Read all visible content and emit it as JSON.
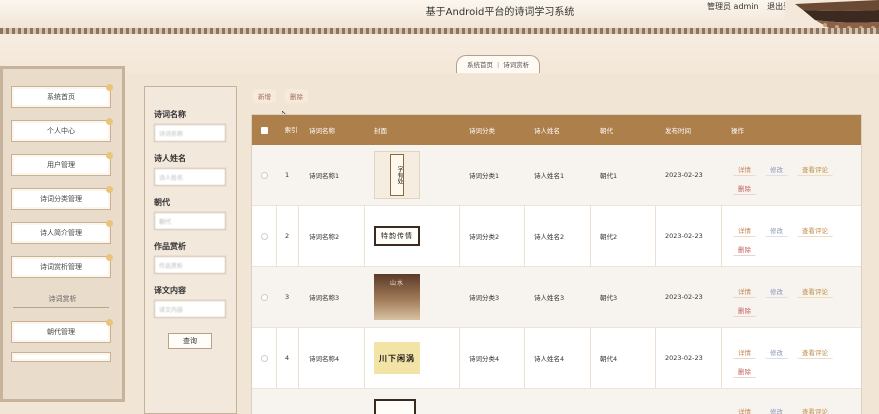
{
  "header": {
    "title": "基于Android平台的诗词学习系统",
    "user_label": "管理员 admin",
    "logout_label": "退出登录"
  },
  "breadcrumb": {
    "home": "系统首页",
    "separator": "|",
    "current": "诗词赏析"
  },
  "sidebar": {
    "items": [
      {
        "label": "系统首页"
      },
      {
        "label": "个人中心"
      },
      {
        "label": "用户管理"
      },
      {
        "label": "诗词分类管理"
      },
      {
        "label": "诗人简介管理"
      },
      {
        "label": "诗词赏析管理"
      }
    ],
    "section_label": "诗词赏析",
    "items2": [
      {
        "label": "朝代管理"
      }
    ]
  },
  "search": {
    "fields": [
      {
        "label": "诗词名称",
        "placeholder": "诗词名称"
      },
      {
        "label": "诗人姓名",
        "placeholder": "诗人姓名"
      },
      {
        "label": "朝代",
        "placeholder": "朝代"
      },
      {
        "label": "作品赏析",
        "placeholder": "作品赏析"
      },
      {
        "label": "译文内容",
        "placeholder": "译文内容"
      }
    ],
    "button_label": "查询"
  },
  "toolbar": {
    "add_label": "新增",
    "delete_label": "删除"
  },
  "table": {
    "columns": [
      "索引",
      "诗词名称",
      "封面",
      "诗词分类",
      "诗人姓名",
      "朝代",
      "发布时间",
      "操作"
    ],
    "rows": [
      {
        "index": "1",
        "name": "诗词名称1",
        "cover_text": "字有处",
        "category": "诗词分类1",
        "poet": "诗人姓名1",
        "dynasty": "朝代1",
        "date": "2023-02-23"
      },
      {
        "index": "2",
        "name": "诗词名称2",
        "cover_text": "特韵传情",
        "category": "诗词分类2",
        "poet": "诗人姓名2",
        "dynasty": "朝代2",
        "date": "2023-02-23"
      },
      {
        "index": "3",
        "name": "诗词名称3",
        "cover_text": "山水",
        "category": "诗词分类3",
        "poet": "诗人姓名3",
        "dynasty": "朝代3",
        "date": "2023-02-23"
      },
      {
        "index": "4",
        "name": "诗词名称4",
        "cover_text": "川下闲涡",
        "category": "诗词分类4",
        "poet": "诗人姓名4",
        "dynasty": "朝代4",
        "date": "2023-02-23"
      }
    ],
    "actions": {
      "detail": "详情",
      "edit": "修改",
      "comment": "查看评论",
      "delete": "删除"
    }
  },
  "colors": {
    "table_header": "#ad7f4b",
    "page_bg": "#f1e5d6",
    "accent": "#c7895a"
  }
}
